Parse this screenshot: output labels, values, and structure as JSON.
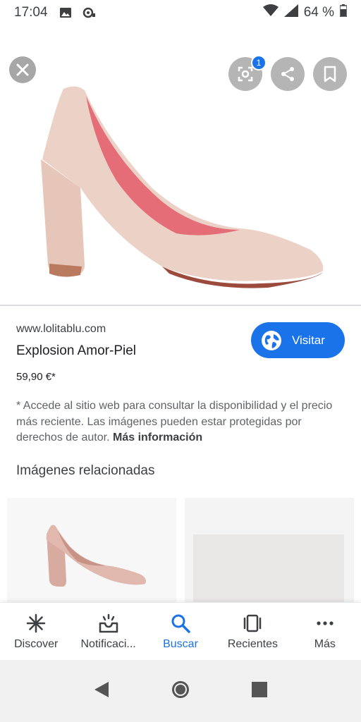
{
  "status_bar": {
    "time": "17:04",
    "battery": "64 %"
  },
  "hero": {
    "lens_badge_count": "1"
  },
  "result": {
    "source": "www.lolitablu.com",
    "title": "Explosion Amor-Piel",
    "price": "59,90 €*",
    "visit_label": "Visitar",
    "disclaimer": "* Accede al sitio web para consultar la disponibilidad y el precio más reciente. Las imágenes pueden estar protegidas por derechos de autor.",
    "more_info": "Más información"
  },
  "related": {
    "heading": "Imágenes relacionadas"
  },
  "bottom_nav": {
    "items": [
      {
        "label": "Discover",
        "icon": "asterisk-icon"
      },
      {
        "label": "Notificaci...",
        "icon": "inbox-icon"
      },
      {
        "label": "Buscar",
        "icon": "search-icon"
      },
      {
        "label": "Recientes",
        "icon": "recents-icon"
      },
      {
        "label": "Más",
        "icon": "more-dots-icon"
      }
    ],
    "active_index": 2
  },
  "colors": {
    "accent": "#1a73e8",
    "shoe": "#ecd1c6",
    "lining": "#e46d77"
  }
}
